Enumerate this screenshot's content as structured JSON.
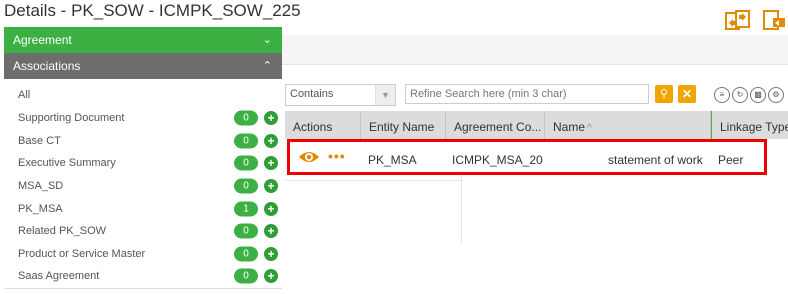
{
  "page": {
    "title": "Details - PK_SOW - ICMPK_SOW_225"
  },
  "header_icons": [
    "copy-doc-icon",
    "edit-doc-icon"
  ],
  "sidebar": {
    "agreement_label": "Agreement",
    "associations_label": "Associations",
    "all_label": "All",
    "items": [
      {
        "label": "Supporting Document",
        "count": "0"
      },
      {
        "label": "Base CT",
        "count": "0"
      },
      {
        "label": "Executive Summary",
        "count": "0"
      },
      {
        "label": "MSA_SD",
        "count": "0"
      },
      {
        "label": "PK_MSA",
        "count": "1"
      },
      {
        "label": "Related PK_SOW",
        "count": "0"
      },
      {
        "label": "Product or Service Master",
        "count": "0"
      },
      {
        "label": "Saas Agreement",
        "count": "0"
      }
    ]
  },
  "filter": {
    "selected": "Contains",
    "search_placeholder": "Refine Search here (min 3 char)"
  },
  "grid": {
    "columns": [
      "Actions",
      "Entity Name",
      "Agreement Co...",
      "Name",
      "Linkage Type"
    ],
    "rows": [
      {
        "entity_name": "PK_MSA",
        "agreement_code": "ICMPK_MSA_20",
        "name": "statement of work",
        "linkage_type": "Peer"
      }
    ]
  },
  "colors": {
    "accent_green": "#3cb043",
    "section_grey": "#6d6d6d",
    "action_orange": "#f0a500",
    "highlight_red": "#e00000"
  }
}
